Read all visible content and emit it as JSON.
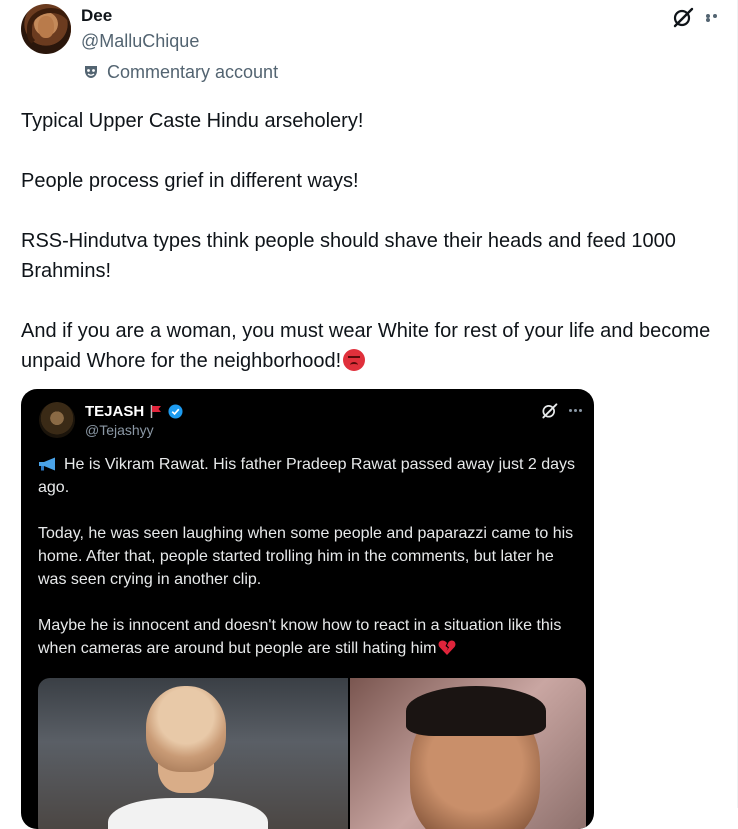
{
  "author": {
    "display_name": "Dee",
    "handle": "@MalluChique",
    "label": "Commentary account"
  },
  "tweet": {
    "paragraphs": [
      "Typical Upper Caste Hindu arseholery!",
      "People process grief in different ways!",
      "RSS-Hindutva types think people should shave their heads and feed 1000 Brahmins!",
      "And if you are a woman, you must wear White for rest of your life and become unpaid Whore for the neighborhood!"
    ]
  },
  "embed": {
    "author_name": "TEJASH",
    "author_handle": "@Tejashyy",
    "paragraphs": [
      "He is Vikram Rawat. His father Pradeep Rawat passed away just 2 days ago.",
      "Today, he was seen laughing when some people and paparazzi came to his home. After that, people started trolling him in the comments, but later he was seen crying in another clip.",
      "Maybe he is innocent and doesn't know how to react in a situation like this when cameras are around but people are still hating him"
    ]
  },
  "icons": {
    "grok": "grok-icon",
    "more": "more-icon",
    "commentary": "mask-icon",
    "angry": "angry-face-emoji",
    "megaphone": "megaphone-emoji",
    "broken_heart": "broken-heart-emoji",
    "verified": "verified-badge-icon",
    "flag": "red-flag-emoji"
  },
  "colors": {
    "text": "#0f1419",
    "secondary": "#536471",
    "embed_bg": "#000000",
    "verified": "#1d9bf0"
  }
}
